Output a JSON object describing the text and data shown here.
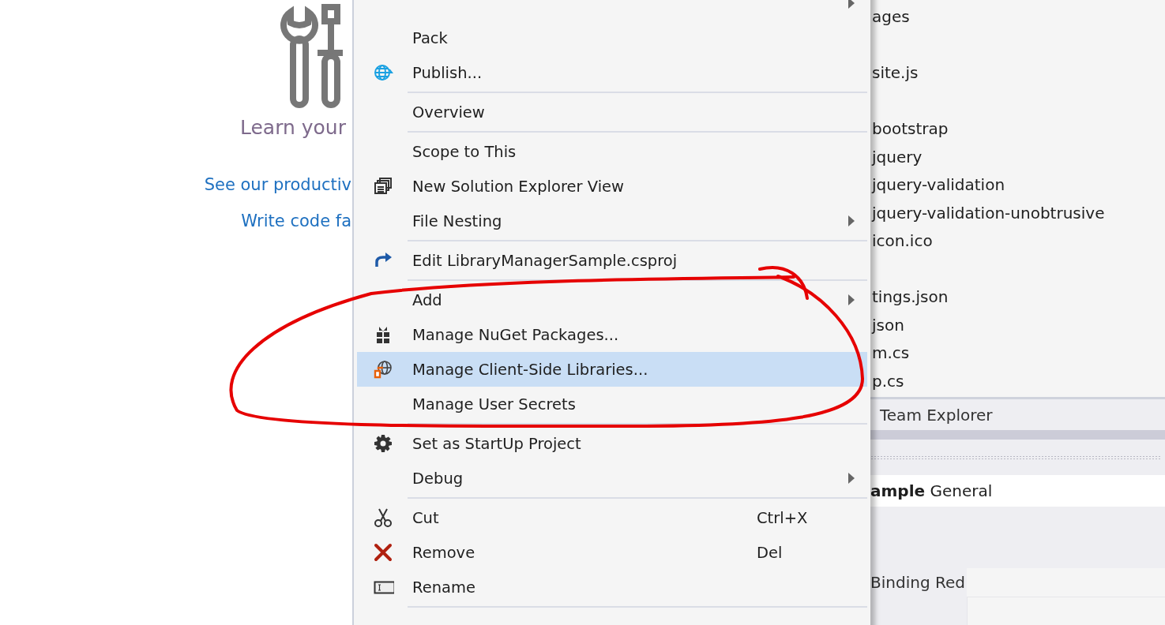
{
  "start_page": {
    "title": "Learn your",
    "links": [
      {
        "label": "See our productiv"
      },
      {
        "label": "Write code fa"
      }
    ]
  },
  "context_menu": {
    "items": [
      {
        "kind": "item",
        "submenu": true,
        "selected": false
      },
      {
        "kind": "item",
        "label": "Pack",
        "submenu": false,
        "selected": false
      },
      {
        "kind": "item",
        "label": "Publish...",
        "submenu": false,
        "selected": false
      },
      {
        "kind": "separator"
      },
      {
        "kind": "item",
        "label": "Overview",
        "submenu": false,
        "selected": false
      },
      {
        "kind": "separator"
      },
      {
        "kind": "item",
        "label": "Scope to This",
        "submenu": false,
        "selected": false
      },
      {
        "kind": "item",
        "label": "New Solution Explorer View",
        "submenu": false,
        "selected": false
      },
      {
        "kind": "item",
        "label": "File Nesting",
        "submenu": true,
        "selected": false
      },
      {
        "kind": "separator"
      },
      {
        "kind": "item",
        "label": "Edit LibraryManagerSample.csproj",
        "submenu": false,
        "selected": false
      },
      {
        "kind": "separator"
      },
      {
        "kind": "item",
        "label": "Add",
        "submenu": true,
        "selected": false
      },
      {
        "kind": "item",
        "label": "Manage NuGet Packages...",
        "submenu": false,
        "selected": false
      },
      {
        "kind": "item",
        "label": "Manage Client-Side Libraries...",
        "submenu": false,
        "selected": true
      },
      {
        "kind": "item",
        "label": "Manage User Secrets",
        "submenu": false,
        "selected": false
      },
      {
        "kind": "separator"
      },
      {
        "kind": "item",
        "label": "Set as StartUp Project",
        "submenu": false,
        "selected": false
      },
      {
        "kind": "item",
        "label": "Debug",
        "submenu": true,
        "selected": false
      },
      {
        "kind": "separator"
      },
      {
        "kind": "item",
        "label": "Cut",
        "shortcut": "Ctrl+X",
        "submenu": false,
        "selected": false
      },
      {
        "kind": "item",
        "label": "Remove",
        "shortcut": "Del",
        "submenu": false,
        "selected": false
      },
      {
        "kind": "item",
        "label": "Rename",
        "submenu": false,
        "selected": false
      },
      {
        "kind": "separator"
      }
    ]
  },
  "solution_explorer": {
    "items": [
      {
        "label": "ages",
        "gap_before": false
      },
      {
        "label": "site.js",
        "gap_before": true
      },
      {
        "label": "bootstrap",
        "gap_before": true
      },
      {
        "label": "jquery",
        "gap_before": false
      },
      {
        "label": "jquery-validation",
        "gap_before": false
      },
      {
        "label": "jquery-validation-unobtrusive",
        "gap_before": false
      },
      {
        "label": "icon.ico",
        "gap_before": false
      },
      {
        "label": "tings.json",
        "gap_before": true
      },
      {
        "label": "json",
        "gap_before": false
      },
      {
        "label": "m.cs",
        "gap_before": false
      },
      {
        "label": "p.cs",
        "gap_before": false
      }
    ]
  },
  "team_explorer": {
    "title": "Team Explorer",
    "project": "**ample** General",
    "item": "Binding Red"
  }
}
